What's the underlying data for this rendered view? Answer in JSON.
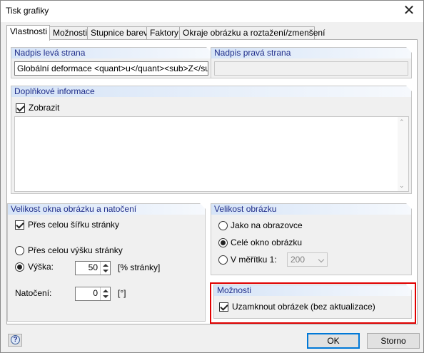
{
  "window": {
    "title": "Tisk grafiky",
    "close_icon": "close-icon"
  },
  "tabs": [
    "Vlastnosti",
    "Možnosti",
    "Stupnice barev",
    "Faktory",
    "Okraje obrázku a roztažení/zmenšení"
  ],
  "left_caption": {
    "header": "Nadpis levá strana",
    "value": "Globální deformace <quant>u</quant><sub>Z</sub>"
  },
  "right_caption": {
    "header": "Nadpis pravá strana",
    "value": ""
  },
  "extra_info": {
    "header": "Doplňkové informace",
    "show_label": "Zobrazit",
    "show_checked": true,
    "text": ""
  },
  "window_size": {
    "header": "Velikost okna obrázku a natočení",
    "full_width_label": "Přes celou šířku stránky",
    "full_width_checked": true,
    "full_height_label": "Přes celou výšku stránky",
    "height_label": "Výška:",
    "height_value": "50",
    "height_unit": "[% stránky]",
    "rotation_label": "Natočení:",
    "rotation_value": "0",
    "rotation_unit": "[°]"
  },
  "image_size": {
    "header": "Velikost obrázku",
    "opt1": "Jako na obrazovce",
    "opt2": "Celé okno obrázku",
    "opt3": "V měřítku 1:",
    "scale_value": "200"
  },
  "options": {
    "header": "Možnosti",
    "lock_label": "Uzamknout obrázek (bez aktualizace)",
    "lock_checked": true
  },
  "footer": {
    "ok": "OK",
    "cancel": "Storno",
    "help_symbol": "?"
  }
}
